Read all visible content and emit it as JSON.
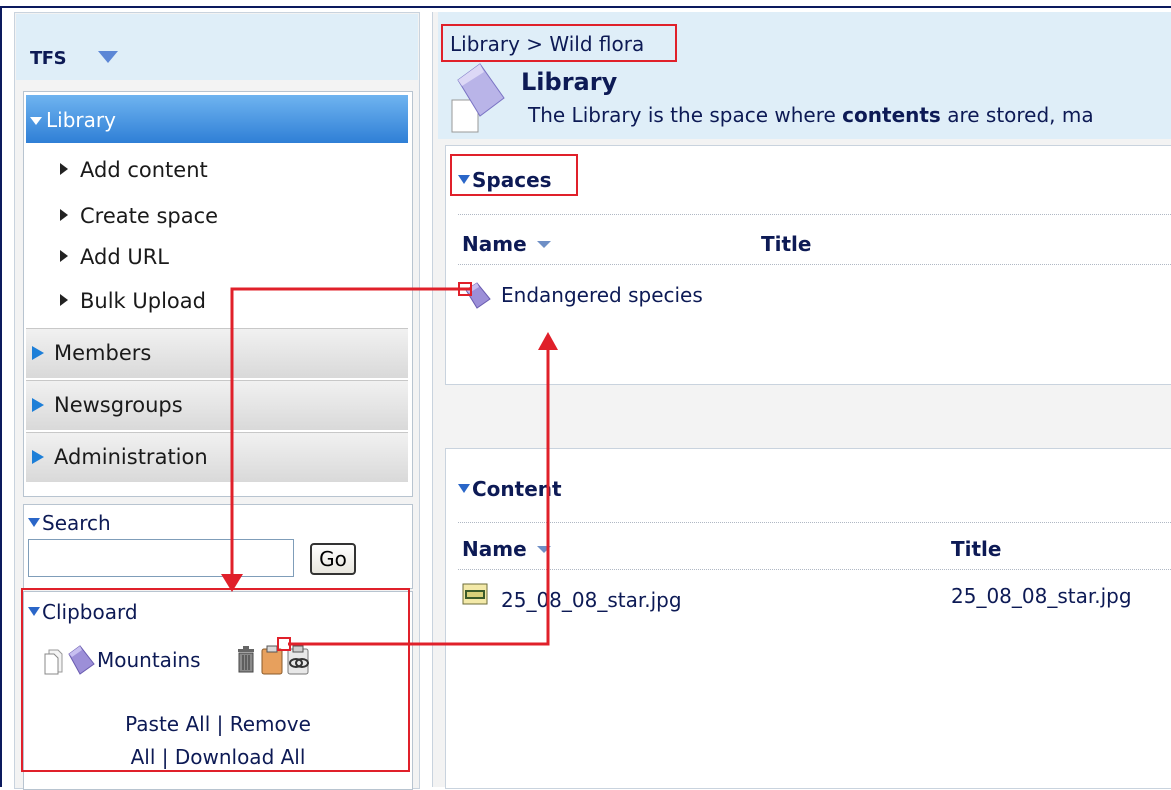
{
  "app": {
    "brand": "TFS",
    "accent_color": "#1d7fd8",
    "annotation_color": "#e0202a"
  },
  "sidebar": {
    "library": {
      "label": "Library",
      "actions": [
        "Add content",
        "Create space",
        "Add URL",
        "Bulk Upload"
      ]
    },
    "sections": [
      "Members",
      "Newsgroups",
      "Administration"
    ]
  },
  "search": {
    "title": "Search",
    "input_value": "",
    "go_label": "Go"
  },
  "clipboard": {
    "title": "Clipboard",
    "item_name": "Mountains",
    "icons": [
      "copy-icon",
      "space-icon",
      "delete-icon",
      "paste-icon",
      "paste-link-icon"
    ],
    "paste_all": "Paste All",
    "separator": "|",
    "remove_all_part1": "Remove",
    "remove_all_part2": "All",
    "download_all": "Download All"
  },
  "main": {
    "breadcrumb": "Library > Wild flora",
    "title": "Library",
    "description_before": "The Library is the space where ",
    "description_bold": "contents",
    "description_after": " are stored, ma",
    "spaces": {
      "title": "Spaces",
      "columns": [
        "Name",
        "Title"
      ],
      "rows": [
        {
          "name": "Endangered species",
          "title": ""
        }
      ]
    },
    "content": {
      "title": "Content",
      "columns": [
        "Name",
        "Title"
      ],
      "rows": [
        {
          "name": "25_08_08_star.jpg",
          "title": "25_08_08_star.jpg"
        }
      ]
    }
  }
}
